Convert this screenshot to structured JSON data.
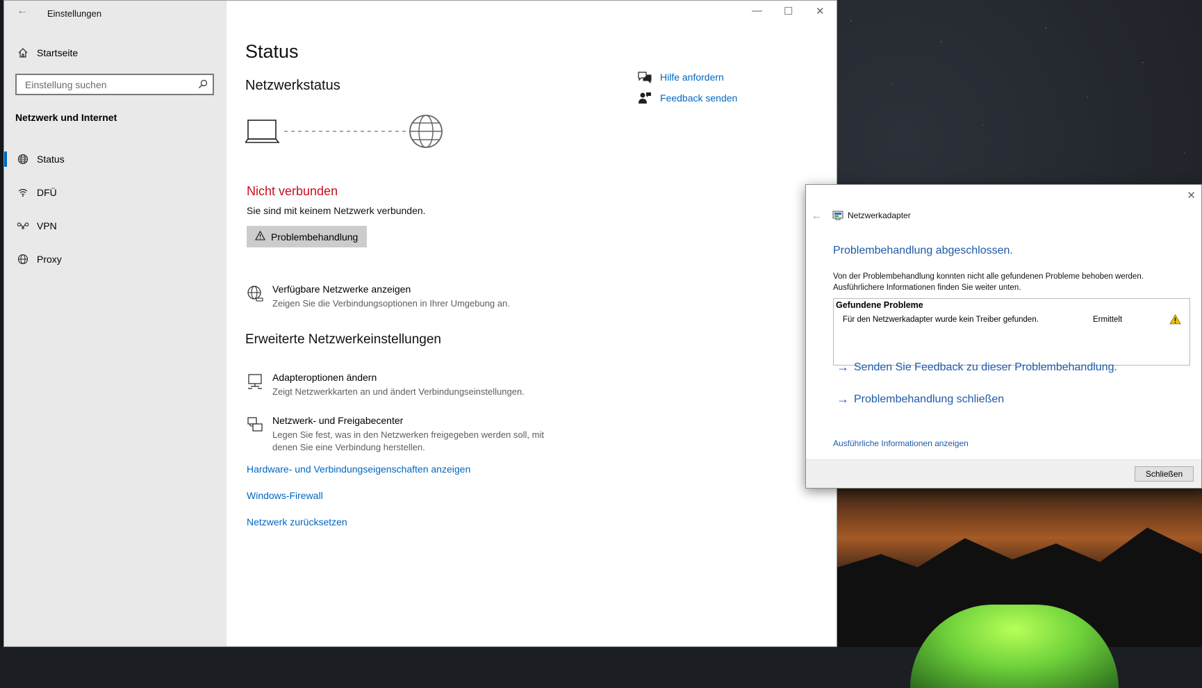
{
  "window": {
    "title": "Einstellungen",
    "controls": {
      "minimize": "—",
      "maximize": "☐",
      "close": "✕"
    }
  },
  "sidebar": {
    "home_label": "Startseite",
    "search_placeholder": "Einstellung suchen",
    "section": "Netzwerk und Internet",
    "items": [
      {
        "label": "Status",
        "icon": "globe-status-icon",
        "active": true
      },
      {
        "label": "DFÜ",
        "icon": "dialup-icon",
        "active": false
      },
      {
        "label": "VPN",
        "icon": "vpn-icon",
        "active": false
      },
      {
        "label": "Proxy",
        "icon": "globe-icon",
        "active": false
      }
    ]
  },
  "main": {
    "page_title": "Status",
    "network_status_heading": "Netzwerkstatus",
    "connection_state": "Nicht verbunden",
    "connection_desc": "Sie sind mit keinem Netzwerk verbunden.",
    "troubleshoot_label": "Problembehandlung",
    "available_networks": {
      "title": "Verfügbare Netzwerke anzeigen",
      "desc": "Zeigen Sie die Verbindungsoptionen in Ihrer Umgebung an."
    },
    "advanced_heading": "Erweiterte Netzwerkeinstellungen",
    "adapter_options": {
      "title": "Adapteroptionen ändern",
      "desc": "Zeigt Netzwerkkarten an und ändert Verbindungseinstellungen."
    },
    "sharing_center": {
      "title": "Netzwerk- und Freigabecenter",
      "desc": "Legen Sie fest, was in den Netzwerken freigegeben werden soll, mit denen Sie eine Verbindung herstellen."
    },
    "links": [
      "Hardware- und Verbindungseigenschaften anzeigen",
      "Windows-Firewall",
      "Netzwerk zurücksetzen"
    ],
    "help": {
      "get_help": "Hilfe anfordern",
      "feedback": "Feedback senden"
    }
  },
  "dialog": {
    "title": "Netzwerkadapter",
    "heading": "Problembehandlung abgeschlossen.",
    "message": "Von der Problembehandlung konnten nicht alle gefundenen Probleme behoben werden. Ausführlichere Informationen finden Sie weiter unten.",
    "problems_header": "Gefundene Probleme",
    "problem_text": "Für den Netzwerkadapter wurde kein Treiber gefunden.",
    "problem_status": "Ermittelt",
    "link_feedback": "Senden Sie Feedback zu dieser Problembehandlung.",
    "link_close_troubleshooter": "Problembehandlung schließen",
    "details_link": "Ausführliche Informationen anzeigen",
    "close_button": "Schließen",
    "close_x": "✕",
    "back_arrow": "←"
  },
  "colors": {
    "accent": "#0067c0",
    "error": "#c50f1f",
    "dialog_link": "#1e5aa8",
    "warning": "#f2c500"
  }
}
